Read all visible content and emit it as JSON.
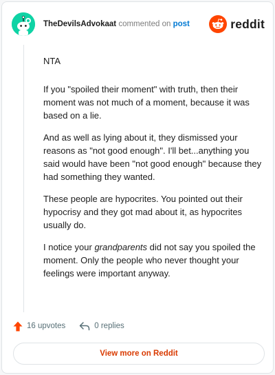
{
  "header": {
    "username": "TheDevilsAdvokaat",
    "commented_text": "commented on",
    "post_link": "post",
    "brand_word": "reddit",
    "avatar_icon": "snoo-avatar-icon",
    "brand_icon": "reddit-logo-icon"
  },
  "comment": {
    "p1": "NTA",
    "p2": "If you \"spoiled their moment\" with truth, then their moment was not much of a moment, because it was based on a lie.",
    "p3": "And as well as lying about it, they dismissed your reasons as \"not good enough\". I'll bet...anything you said would have been \"not good enough\" because they had something they wanted.",
    "p4": "These people are hypocrites. You pointed out their hypocrisy and they got mad about it, as hypocrites usually do.",
    "p5_pre": "I notice your ",
    "p5_em": "grandparents",
    "p5_post": " did not say you spoiled the moment. Only the people who never thought your feelings were important anyway."
  },
  "actions": {
    "upvotes": "16 upvotes",
    "replies": "0 replies",
    "upvote_icon": "upvote-arrow-icon",
    "reply_icon": "reply-arrow-icon"
  },
  "view_more_label": "View more on Reddit",
  "colors": {
    "avatar_bg": "#0fd3a5",
    "reddit_orange": "#ff4500",
    "link_blue": "#0079d3",
    "view_more_text": "#d93a00"
  }
}
